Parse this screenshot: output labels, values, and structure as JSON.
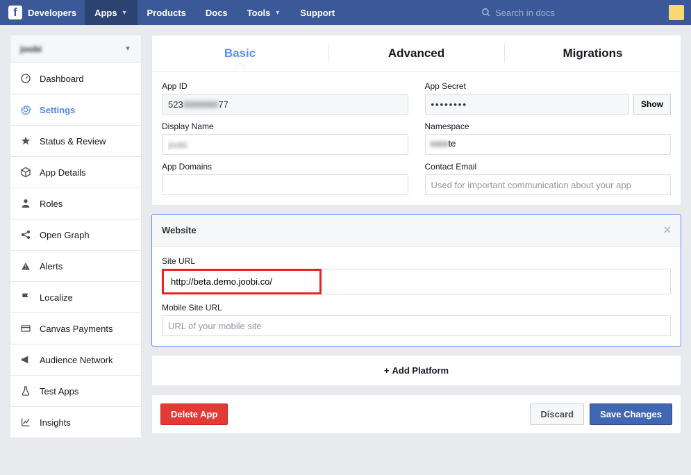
{
  "topnav": {
    "brand": "Developers",
    "items": [
      "Apps",
      "Products",
      "Docs",
      "Tools",
      "Support"
    ],
    "search_placeholder": "Search in docs"
  },
  "sidebar": {
    "app_name": "joobi",
    "items": [
      {
        "label": "Dashboard",
        "icon": "speedometer"
      },
      {
        "label": "Settings",
        "icon": "gear",
        "active": true
      },
      {
        "label": "Status & Review",
        "icon": "star"
      },
      {
        "label": "App Details",
        "icon": "cube"
      },
      {
        "label": "Roles",
        "icon": "person"
      },
      {
        "label": "Open Graph",
        "icon": "share"
      },
      {
        "label": "Alerts",
        "icon": "warning"
      },
      {
        "label": "Localize",
        "icon": "flag"
      },
      {
        "label": "Canvas Payments",
        "icon": "card"
      },
      {
        "label": "Audience Network",
        "icon": "megaphone"
      },
      {
        "label": "Test Apps",
        "icon": "flask"
      },
      {
        "label": "Insights",
        "icon": "chart"
      }
    ]
  },
  "tabs": {
    "basic": "Basic",
    "advanced": "Advanced",
    "migrations": "Migrations"
  },
  "basic": {
    "app_id_label": "App ID",
    "app_id_value": "523            77",
    "app_secret_label": "App Secret",
    "app_secret_value": "••••••••",
    "show_button": "Show",
    "display_name_label": "Display Name",
    "display_name_value": "",
    "namespace_label": "Namespace",
    "namespace_value": "     te",
    "app_domains_label": "App Domains",
    "app_domains_value": "",
    "contact_email_label": "Contact Email",
    "contact_email_value": "",
    "contact_email_placeholder": "Used for important communication about your app"
  },
  "website": {
    "title": "Website",
    "site_url_label": "Site URL",
    "site_url_value": "http://beta.demo.joobi.co/",
    "mobile_url_label": "Mobile Site URL",
    "mobile_url_value": "",
    "mobile_url_placeholder": "URL of your mobile site"
  },
  "add_platform": "Add Platform",
  "footer": {
    "delete": "Delete App",
    "discard": "Discard",
    "save": "Save Changes"
  }
}
